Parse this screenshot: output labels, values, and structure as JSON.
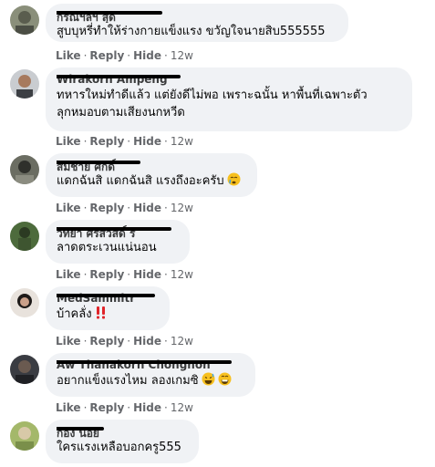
{
  "comments": [
    {
      "author": "กรณีฯลฯ สุด",
      "lines": [
        "สูบบุหรี่ทำให้ร่างกายแข็งแรง ขวัญใจนายสิบ555555"
      ],
      "actions": {
        "like": "Like",
        "reply": "Reply",
        "hide": "Hide",
        "time": "12w"
      }
    },
    {
      "author": "Wirakorn Ampeng",
      "lines": [
        "ทหารใหม่ทำดีแล้ว แต่ยังดีไม่พอ เพราะฉนั้น หาพื้นที่เฉพาะตัว",
        "ลุกหมอบตามเสียงนกหวีด"
      ],
      "actions": {
        "like": "Like",
        "reply": "Reply",
        "hide": "Hide",
        "time": "12w"
      }
    },
    {
      "author": "สมชาย ศักดิ์",
      "lines": [
        "แดกฉันสิ แดกฉันสิ แรงถึงอะครับ"
      ],
      "emoji": "crying-face",
      "actions": {
        "like": "Like",
        "reply": "Reply",
        "hide": "Hide",
        "time": "12w"
      }
    },
    {
      "author": "วิทยา ศรีสวัสดิ์ ร",
      "lines": [
        "ลาดตระเวนแน่นอน"
      ],
      "actions": {
        "like": "Like",
        "reply": "Reply",
        "hide": "Hide",
        "time": "12w"
      }
    },
    {
      "author": "MedSammitr",
      "lines": [
        "บ้าคลั่ง"
      ],
      "emoji": "double-exclamation",
      "actions": {
        "like": "Like",
        "reply": "Reply",
        "hide": "Hide",
        "time": "12w"
      }
    },
    {
      "author": "Aw Thanakorn Chongnon",
      "lines": [
        "อยากแข็งแรงไหม ลองเกมซิ"
      ],
      "emoji": "grinning-sweat-faces",
      "actions": {
        "like": "Like",
        "reply": "Reply",
        "hide": "Hide",
        "time": "12w"
      }
    },
    {
      "author": "ก้อง น้อย",
      "lines": [
        "ใครแรงเหลือบอกครู555"
      ],
      "actions": {
        "like": "Like",
        "reply": "Reply",
        "hide": "Hide",
        "time": "12w"
      }
    }
  ]
}
